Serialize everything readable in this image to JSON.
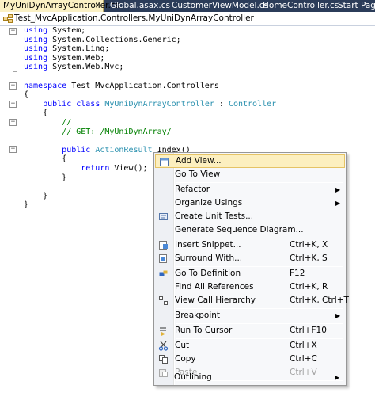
{
  "tabs": [
    {
      "label": "MyUniDynArrayController.cs",
      "active": true,
      "close": "×"
    },
    {
      "label": "Global.asax.cs",
      "active": false
    },
    {
      "label": "CustomerViewModel.cs",
      "active": false
    },
    {
      "label": "HomeController.cs",
      "active": false
    },
    {
      "label": "Start Page",
      "active": false
    }
  ],
  "navbar": {
    "type_path": "Test_MvcApplication.Controllers.MyUniDynArrayController"
  },
  "code": {
    "lines": [
      "using System;",
      "using System.Collections.Generic;",
      "using System.Linq;",
      "using System.Web;",
      "using System.Web.Mvc;",
      "",
      "namespace Test_MvcApplication.Controllers",
      "{",
      "    public class MyUniDynArrayController : Controller",
      "    {",
      "        //",
      "        // GET: /MyUniDynArray/",
      "",
      "        public ActionResult Index()",
      "        {",
      "            return View();",
      "        }",
      "",
      "    }",
      "}"
    ]
  },
  "context_menu": {
    "items": [
      {
        "label": "Add View...",
        "shortcut": "",
        "icon": "add-view-icon",
        "highlighted": true
      },
      {
        "label": "Go To View",
        "shortcut": "",
        "icon": "go-to-view-icon"
      },
      {
        "separator": true
      },
      {
        "label": "Refactor",
        "shortcut": "",
        "submenu": true
      },
      {
        "label": "Organize Usings",
        "shortcut": "",
        "submenu": true
      },
      {
        "label": "Create Unit Tests...",
        "shortcut": "",
        "icon": "unit-test-icon"
      },
      {
        "label": "Generate Sequence Diagram...",
        "shortcut": ""
      },
      {
        "separator": true
      },
      {
        "label": "Insert Snippet...",
        "shortcut": "Ctrl+K, X",
        "icon": "snippet-icon"
      },
      {
        "label": "Surround With...",
        "shortcut": "Ctrl+K, S",
        "icon": "surround-icon"
      },
      {
        "separator": true
      },
      {
        "label": "Go To Definition",
        "shortcut": "F12",
        "icon": "definition-icon"
      },
      {
        "label": "Find All References",
        "shortcut": "Ctrl+K, R"
      },
      {
        "label": "View Call Hierarchy",
        "shortcut": "Ctrl+K, Ctrl+T",
        "icon": "call-hierarchy-icon"
      },
      {
        "separator": true
      },
      {
        "label": "Breakpoint",
        "shortcut": "",
        "submenu": true
      },
      {
        "separator": true
      },
      {
        "label": "Run To Cursor",
        "shortcut": "Ctrl+F10",
        "icon": "run-to-cursor-icon"
      },
      {
        "separator": true
      },
      {
        "label": "Cut",
        "shortcut": "Ctrl+X",
        "icon": "cut-icon"
      },
      {
        "label": "Copy",
        "shortcut": "Ctrl+C",
        "icon": "copy-icon"
      },
      {
        "label": "Paste",
        "shortcut": "Ctrl+V",
        "icon": "paste-icon",
        "disabled": true
      },
      {
        "separator": true
      },
      {
        "label": "Outlining",
        "shortcut": "",
        "submenu": true
      }
    ],
    "submenu_arrow": "▶"
  },
  "colors": {
    "tab_strip": "#2b3c59",
    "active_tab": "#fbf1c4",
    "keyword": "#0000ff",
    "type": "#2b91af",
    "comment": "#008000",
    "menu_highlight": "#fcefbf"
  }
}
